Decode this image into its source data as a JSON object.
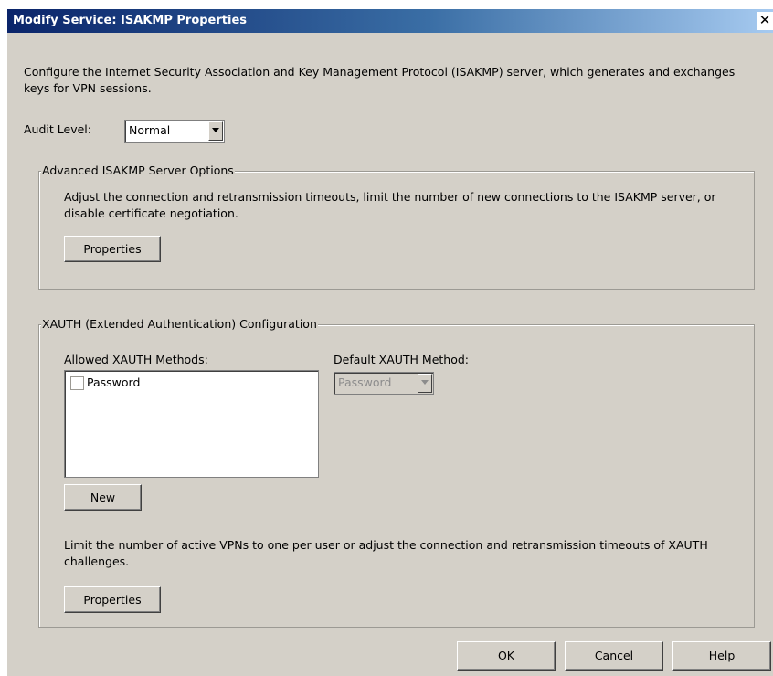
{
  "window": {
    "title": "Modify Service: ISAKMP Properties",
    "close_glyph": "✕"
  },
  "description": "Configure the Internet Security Association and Key Management Protocol (ISAKMP) server, which generates and exchanges keys for VPN sessions.",
  "audit": {
    "label": "Audit Level:",
    "value": "Normal"
  },
  "advanced": {
    "title": "Advanced ISAKMP Server Options",
    "description": "Adjust the connection and retransmission timeouts, limit the number of new connections to the ISAKMP server, or disable certificate negotiation.",
    "properties_label": "Properties"
  },
  "xauth": {
    "title": "XAUTH (Extended Authentication) Configuration",
    "allowed_label": "Allowed XAUTH Methods:",
    "methods": [
      {
        "label": "Password",
        "checked": false
      }
    ],
    "default_label": "Default XAUTH Method:",
    "default_value": "Password",
    "new_label": "New",
    "description": "Limit the number of active VPNs to one per user or adjust the connection and retransmission timeouts of XAUTH challenges.",
    "properties_label": "Properties"
  },
  "footer": {
    "ok": "OK",
    "cancel": "Cancel",
    "help": "Help"
  }
}
